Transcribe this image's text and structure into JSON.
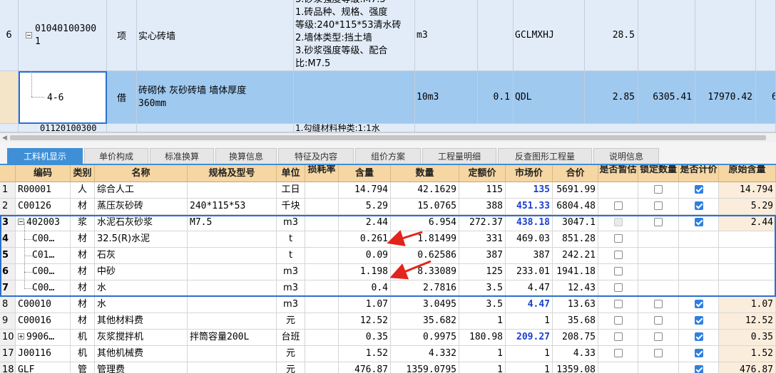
{
  "upper": {
    "row_top_partial": {
      "desc": "3.砂浆强度等级:M7.5"
    },
    "row1": {
      "index": "6",
      "code_line1": "01040100300",
      "code_line2": "1",
      "type": "项",
      "name": "实心砖墙",
      "desc_lines": [
        "1.砖品种、规格、强度",
        "等级:240*115*53清水砖",
        "2.墙体类型:挡土墙",
        "3.砂浆强度等级、配合",
        "比:M7.5"
      ],
      "unit": "m3",
      "formula": "GCLMXHJ",
      "quantity": "28.5"
    },
    "row2": {
      "code": "4-6",
      "type": "借",
      "name_line1": "砖砌体 灰砂砖墙 墙体厚度",
      "name_line2": "360mm",
      "unit": "10m3",
      "ratio": "0.1",
      "formula": "QDL",
      "quantity": "2.85",
      "unit_price": "6305.41",
      "total": "17970.42",
      "extra": "6"
    },
    "row3": {
      "code": "01120100300",
      "name": "",
      "desc": "1.勾缝材料种类:1:1水"
    }
  },
  "tabs": [
    "工料机显示",
    "单价构成",
    "标准换算",
    "换算信息",
    "特征及内容",
    "组价方案",
    "工程量明细",
    "反查图形工程量",
    "说明信息"
  ],
  "columns": [
    "编码",
    "类别",
    "名称",
    "规格及型号",
    "单位",
    "损耗率",
    "含量",
    "数量",
    "定额价",
    "市场价",
    "合价",
    "是否暂估",
    "锁定数量",
    "是否计价",
    "原始含量"
  ],
  "rows": [
    {
      "idx": "1",
      "code": "R00001",
      "cat": "人",
      "name": "综合人工",
      "spec": "",
      "unit": "工日",
      "loss": "",
      "content": "14.794",
      "qty": "42.1629",
      "base": "115",
      "market": "135",
      "total": "5691.99",
      "est": "",
      "lock": "off",
      "price": "on",
      "orig": "14.794",
      "marketBlue": true
    },
    {
      "idx": "2",
      "code": "C00126",
      "cat": "材",
      "name": "蒸压灰砂砖",
      "spec": "240*115*53",
      "unit": "千块",
      "loss": "",
      "content": "5.29",
      "qty": "15.0765",
      "base": "388",
      "market": "451.33",
      "total": "6804.48",
      "est": "off",
      "lock": "off",
      "price": "on",
      "orig": "5.29",
      "marketBlue": true
    },
    {
      "idx": "3",
      "code": "402003",
      "cat": "浆",
      "name": "水泥石灰砂浆",
      "spec": "M7.5",
      "unit": "m3",
      "loss": "",
      "content": "2.44",
      "qty": "6.954",
      "base": "272.37",
      "market": "438.18",
      "total": "3047.1",
      "est": "dis",
      "lock": "off",
      "price": "on",
      "orig": "2.44",
      "marketBlue": true
    },
    {
      "idx": "4",
      "code": "C00…",
      "cat": "材",
      "name": "32.5(R)水泥",
      "spec": "",
      "unit": "t",
      "loss": "",
      "content": "0.261",
      "qty": "1.81499",
      "base": "331",
      "market": "469.03",
      "total": "851.28",
      "est": "off",
      "lock": "",
      "price": "",
      "orig": "",
      "marketBlue": false
    },
    {
      "idx": "5",
      "code": "C01…",
      "cat": "材",
      "name": "石灰",
      "spec": "",
      "unit": "t",
      "loss": "",
      "content": "0.09",
      "qty": "0.62586",
      "base": "387",
      "market": "387",
      "total": "242.21",
      "est": "off",
      "lock": "",
      "price": "",
      "orig": "",
      "marketBlue": false
    },
    {
      "idx": "6",
      "code": "C00…",
      "cat": "材",
      "name": "中砂",
      "spec": "",
      "unit": "m3",
      "loss": "",
      "content": "1.198",
      "qty": "8.33089",
      "base": "125",
      "market": "233.01",
      "total": "1941.18",
      "est": "off",
      "lock": "",
      "price": "",
      "orig": "",
      "marketBlue": false
    },
    {
      "idx": "7",
      "code": "C00…",
      "cat": "材",
      "name": "水",
      "spec": "",
      "unit": "m3",
      "loss": "",
      "content": "0.4",
      "qty": "2.7816",
      "base": "3.5",
      "market": "4.47",
      "total": "12.43",
      "est": "off",
      "lock": "",
      "price": "",
      "orig": "",
      "marketBlue": false
    },
    {
      "idx": "8",
      "code": "C00010",
      "cat": "材",
      "name": "水",
      "spec": "",
      "unit": "m3",
      "loss": "",
      "content": "1.07",
      "qty": "3.0495",
      "base": "3.5",
      "market": "4.47",
      "total": "13.63",
      "est": "off",
      "lock": "off",
      "price": "on",
      "orig": "1.07",
      "marketBlue": true
    },
    {
      "idx": "9",
      "code": "C00016",
      "cat": "材",
      "name": "其他材料费",
      "spec": "",
      "unit": "元",
      "loss": "",
      "content": "12.52",
      "qty": "35.682",
      "base": "1",
      "market": "1",
      "total": "35.68",
      "est": "off",
      "lock": "off",
      "price": "on",
      "orig": "12.52",
      "marketBlue": false
    },
    {
      "idx": "10",
      "code": "9906…",
      "cat": "机",
      "name": "灰浆搅拌机",
      "spec": "拌筒容量200L",
      "unit": "台班",
      "loss": "",
      "content": "0.35",
      "qty": "0.9975",
      "base": "180.98",
      "market": "209.27",
      "total": "208.75",
      "est": "off",
      "lock": "off",
      "price": "on",
      "orig": "0.35",
      "marketBlue": true
    },
    {
      "idx": "17",
      "code": "J00116",
      "cat": "机",
      "name": "其他机械费",
      "spec": "",
      "unit": "元",
      "loss": "",
      "content": "1.52",
      "qty": "4.332",
      "base": "1",
      "market": "1",
      "total": "4.33",
      "est": "off",
      "lock": "off",
      "price": "on",
      "orig": "1.52",
      "marketBlue": false
    },
    {
      "idx": "18",
      "code": "GLF",
      "cat": "管",
      "name": "管理费",
      "spec": "",
      "unit": "元",
      "loss": "",
      "content": "476.87",
      "qty": "1359.0795",
      "base": "1",
      "market": "1",
      "total": "1359.08",
      "est": "",
      "lock": "",
      "price": "on",
      "orig": "476.87",
      "marketBlue": false
    }
  ],
  "colors": {
    "header_bg": "#f6d6a3",
    "selected_row": "#9fc9ef",
    "upper_bg": "#e2ecf8",
    "tab_active": "#3f8fd6",
    "market_blue": "#1a3fd0",
    "annotation_arrow": "#e3231c"
  }
}
